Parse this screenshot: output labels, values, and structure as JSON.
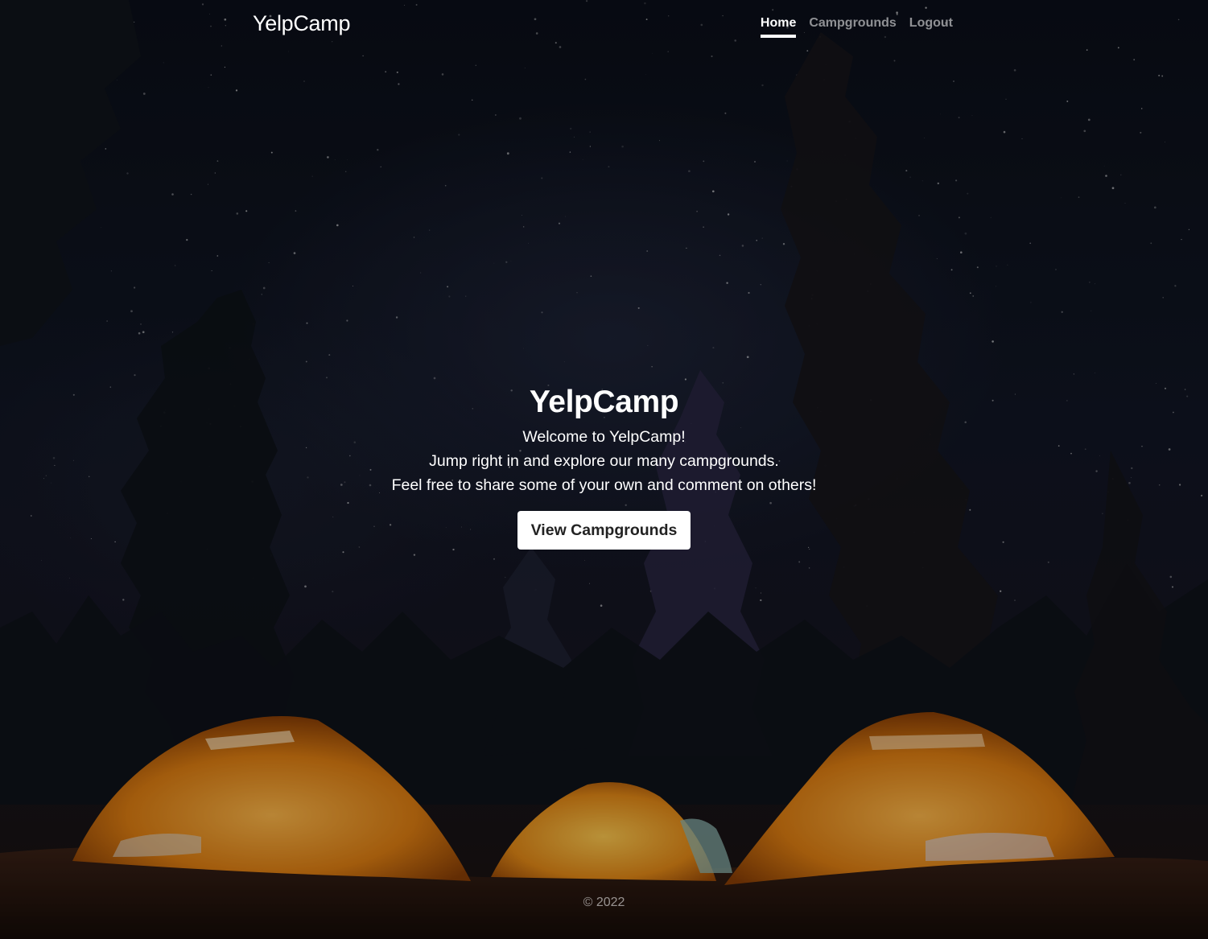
{
  "header": {
    "brand": "YelpCamp",
    "nav": [
      {
        "label": "Home",
        "active": true
      },
      {
        "label": "Campgrounds",
        "active": false
      },
      {
        "label": "Logout",
        "active": false
      }
    ]
  },
  "main": {
    "title": "YelpCamp",
    "lines": [
      "Welcome to YelpCamp!",
      "Jump right in and explore our many campgrounds.",
      "Feel free to share some of your own and comment on others!"
    ],
    "cta_label": "View Campgrounds"
  },
  "footer": {
    "text": "© 2022"
  },
  "colors": {
    "text": "#ffffff",
    "muted": "#8c8c8c",
    "tent": "#e8891d",
    "sky": "#0b0f19"
  },
  "background": {
    "icon": "night-camping-photo"
  }
}
